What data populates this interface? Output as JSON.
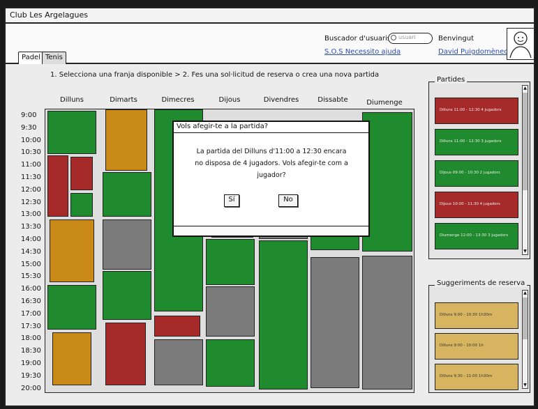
{
  "window": {
    "title": "Club Les Argelagues"
  },
  "tabs": [
    {
      "label": "Padel"
    },
    {
      "label": "Tenis"
    }
  ],
  "header": {
    "search_label": "Buscador d'usuaris",
    "search_placeholder": "usuari",
    "sos_link": "S.O.S Necessito ajuda",
    "welcome": "Benvingut",
    "user_name": "David Puigdomènech"
  },
  "instructions": "1. Selecciona una franja disponible > 2. Fes una sol·licitud de reserva o crea una nova partida",
  "days": [
    "Dilluns",
    "Dimarts",
    "Dimecres",
    "Dijous",
    "Divendres",
    "Dissabte",
    "Diumenge"
  ],
  "times": [
    "9:00",
    "9:30",
    "10:00",
    "10:30",
    "11:00",
    "11:30",
    "12:00",
    "12:30",
    "13:00",
    "13:30",
    "14:00",
    "14:30",
    "15:00",
    "15:30",
    "16:00",
    "16:30",
    "17:00",
    "17:30",
    "18:00",
    "18:30",
    "19:00",
    "19:30",
    "20:00"
  ],
  "dialog": {
    "title": "Vols afegir-te a la partida?",
    "message": "La partida del Dilluns d'11:00 a 12:30 encara no disposa de 4 jugadors. Vols afegir-te com a jugador?",
    "yes": "Sí",
    "no": "No"
  },
  "partides": {
    "title": "Partides",
    "items": [
      {
        "text": "Dilluns 11:00 - 12:30 4 jugadors",
        "color": "#a62a2a"
      },
      {
        "text": "Dilluns 11:00 - 12:30 3 jugadors",
        "color": "#1f8a2e"
      },
      {
        "text": "Dijous 09:00 - 10:30 2 jugadors",
        "color": "#1f8a2e"
      },
      {
        "text": "Dijous 10:00 - 11:30 4 jugadors",
        "color": "#a62a2a"
      },
      {
        "text": "Diumenge 12:00 - 13:30 3 jugadors",
        "color": "#1f8a2e"
      }
    ]
  },
  "suggeriments": {
    "title": "Suggeriments de reserva",
    "items": [
      {
        "text": "Dilluns 9:00 - 10:30 1h30m"
      },
      {
        "text": "Dilluns 9:00 - 10:00 1h"
      },
      {
        "text": "Dilluns 9:30 - 11:00 1h30m"
      }
    ]
  },
  "colors": {
    "available": "#1f8a2e",
    "partial": "#c98a17",
    "full": "#a62a2a",
    "unavailable": "#7b7b7b"
  }
}
